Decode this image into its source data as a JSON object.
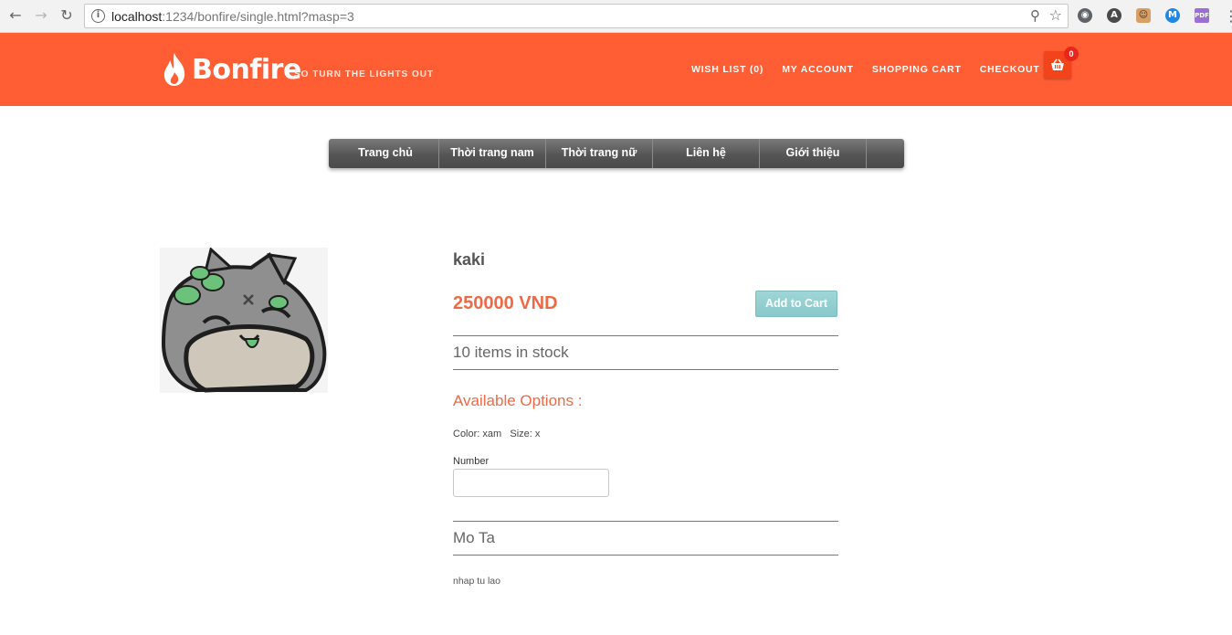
{
  "browser": {
    "url_host": "localhost",
    "url_rest": ":1234/bonfire/single.html?masp=3"
  },
  "header": {
    "brand": "Bonfire",
    "tagline": "SO TURN THE LIGHTS OUT",
    "links": [
      {
        "label": "WISH LIST (0)"
      },
      {
        "label": "MY ACCOUNT"
      },
      {
        "label": "SHOPPING CART"
      },
      {
        "label": "CHECKOUT"
      }
    ],
    "cart_count": "0",
    "accent_color": "#ff5d33"
  },
  "menu": {
    "items": [
      {
        "label": "Trang chủ"
      },
      {
        "label": "Thời trang nam"
      },
      {
        "label": "Thời trang nữ"
      },
      {
        "label": "Liên hệ"
      },
      {
        "label": "Giới thiệu"
      }
    ]
  },
  "product": {
    "name": "kaki",
    "price": "250000 VND",
    "add_to_cart": "Add to Cart",
    "stock": "10 items in stock",
    "options_title": "Available Options :",
    "color_label": "Color:",
    "color_value": "xam",
    "size_label": "Size:",
    "size_value": "x",
    "number_label": "Number",
    "number_value": "",
    "description_title": "Mo Ta",
    "description": "nhap tu lao",
    "price_color": "#ee6a46"
  }
}
